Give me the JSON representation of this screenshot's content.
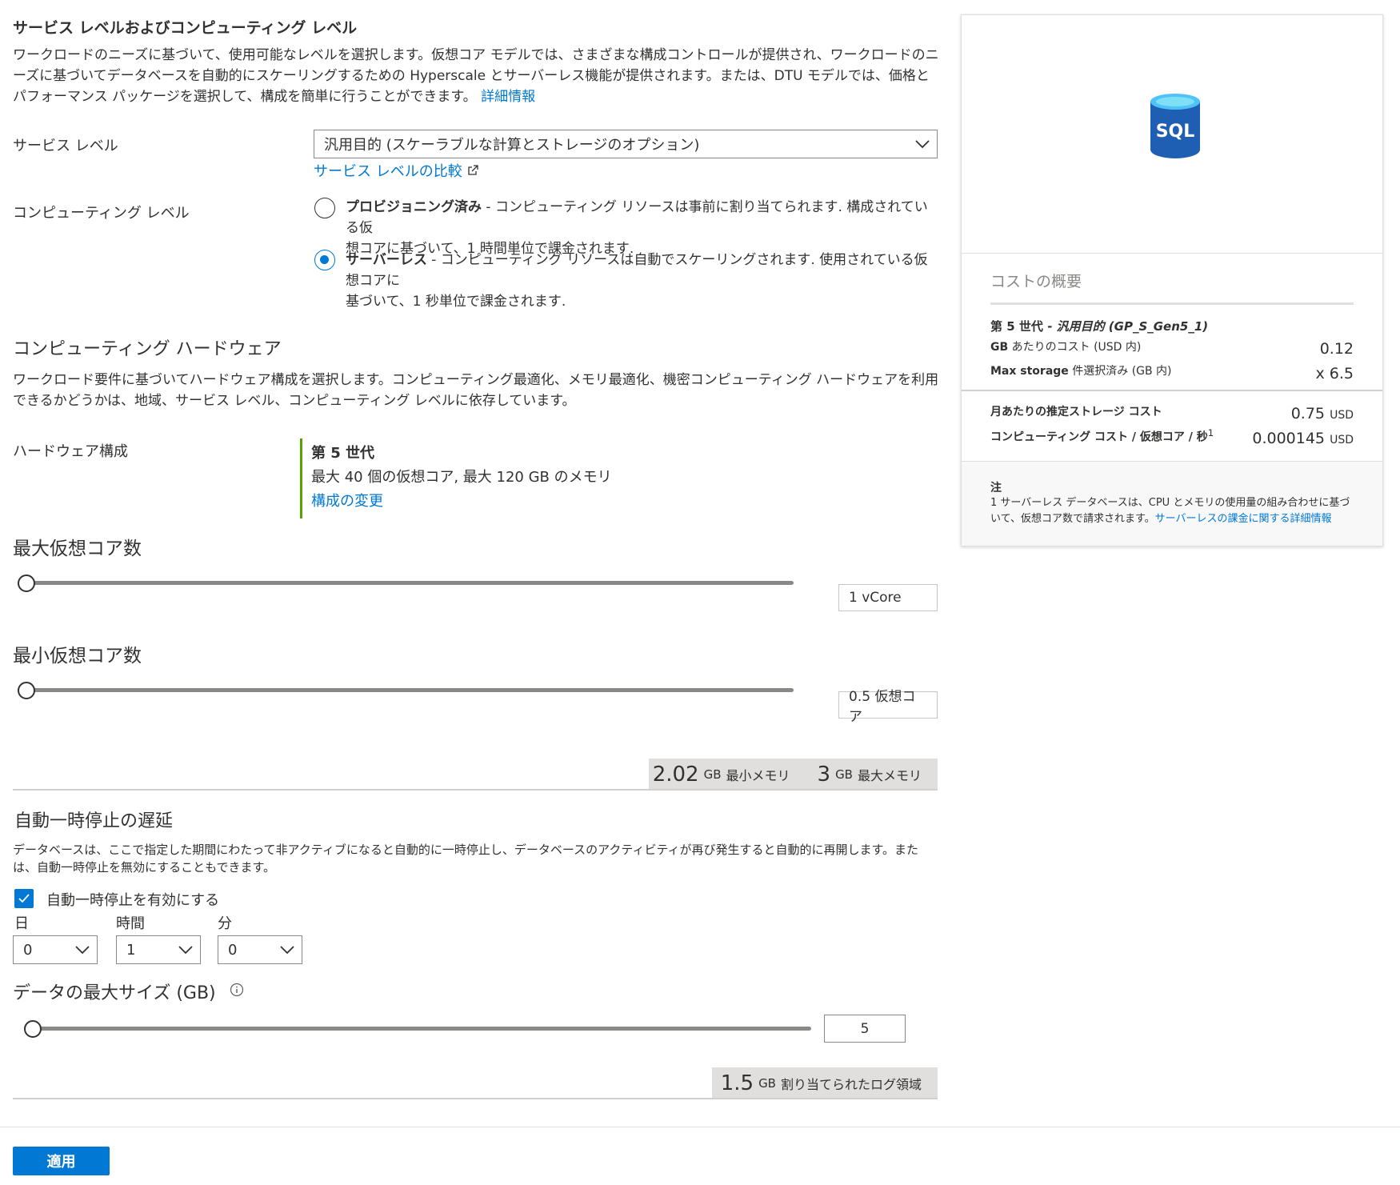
{
  "service_section": {
    "title": "サービス レベルおよびコンピューティング レベル",
    "description": "ワークロードのニーズに基づいて、使用可能なレベルを選択します。仮想コア モデルでは、さまざまな構成コントロールが提供され、ワークロードのニーズに基づいてデータベースを自動的にスケーリングするための Hyperscale とサーバーレス機能が提供されます。または、DTU モデルでは、価格とパフォーマンス パッケージを選択して、構成を簡単に行うことができます。",
    "learn_more": "詳細情報"
  },
  "service_level": {
    "label": "サービス レベル",
    "value": "汎用目的 (スケーラブルな計算とストレージのオプション)",
    "compare_link": "サービス レベルの比較"
  },
  "compute_tier": {
    "label": "コンピューティング レベル",
    "options": [
      {
        "name": "プロビジョニング済み",
        "desc_line1": " - コンピューティング リソースは事前に割り当てられます. 構成されている仮",
        "desc_line2": "想コアに基づいて、1 時間単位で課金されます.",
        "checked": false
      },
      {
        "name": "サーバーレス",
        "desc_line1": " - コンピューティング リソースは自動でスケーリングされます. 使用されている仮想コアに",
        "desc_line2": "基づいて、1 秒単位で課金されます.",
        "checked": true
      }
    ]
  },
  "hardware": {
    "title": "コンピューティング ハードウェア",
    "description": "ワークロード要件に基づいてハードウェア構成を選択します。コンピューティング最適化、メモリ最適化、機密コンピューティング ハードウェアを利用できるかどうかは、地域、サービス レベル、コンピューティング レベルに依存しています。",
    "config_label": "ハードウェア構成",
    "generation": "第 5 世代",
    "spec": "最大 40 個の仮想コア, 最大 120 GB のメモリ",
    "change_link": "構成の変更"
  },
  "max_vcores": {
    "title": "最大仮想コア数",
    "value": "1 vCore",
    "level": 0
  },
  "min_vcores": {
    "title": "最小仮想コア数",
    "value": "0.5 仮想コア",
    "level": 0
  },
  "memory": {
    "min_value": "2.02",
    "min_unit": "GB",
    "min_label": "最小メモリ",
    "max_value": "3",
    "max_unit": "GB",
    "max_label": "最大メモリ"
  },
  "auto_pause": {
    "title": "自動一時停止の遅延",
    "description": "データベースは、ここで指定した期間にわたって非アクティブになると自動的に一時停止し、データベースのアクティビティが再び発生すると自動的に再開します。または、自動一時停止を無効にすることもできます。",
    "checkbox_label": "自動一時停止を有効にする",
    "checked": true,
    "days_label": "日",
    "days_value": "0",
    "hours_label": "時間",
    "hours_value": "1",
    "minutes_label": "分",
    "minutes_value": "0"
  },
  "max_data_size": {
    "title": "データの最大サイズ (GB)",
    "value": "5",
    "level": 0
  },
  "log_space": {
    "value": "1.5",
    "unit": "GB",
    "label": "割り当てられたログ領域"
  },
  "apply_button": "適用",
  "cost_panel": {
    "icon_text": "SQL",
    "title": "コストの概要",
    "gen_prefix": "第 5 世代 - ",
    "gen_sku": "汎用目的 (GP_S_Gen5_1)",
    "cost_per_gb_label": "GB",
    "cost_per_gb_suffix": " あたりのコスト (USD 内)",
    "cost_per_gb_value": "0.12",
    "max_storage_label": "Max storage",
    "max_storage_suffix": " 件選択済み (GB 内)",
    "max_storage_value": "x 6.5",
    "storage_cost_label": "月あたりの推定ストレージ コスト",
    "storage_cost_value": "0.75",
    "compute_cost_label": "コンピューティング コスト / 仮想コア / 秒",
    "compute_cost_sup": "1",
    "compute_cost_value": "0.000145",
    "currency": "USD",
    "note_title": "注",
    "note_text": "1 サーバーレス データベースは、CPU とメモリの使用量の組み合わせに基づいて、仮想コア数で請求されます。",
    "note_link": "サーバーレスの課金に関する詳細情報"
  },
  "colors": {
    "accent": "#0078d4",
    "text": "#323130",
    "band": "#e1dfdd"
  }
}
